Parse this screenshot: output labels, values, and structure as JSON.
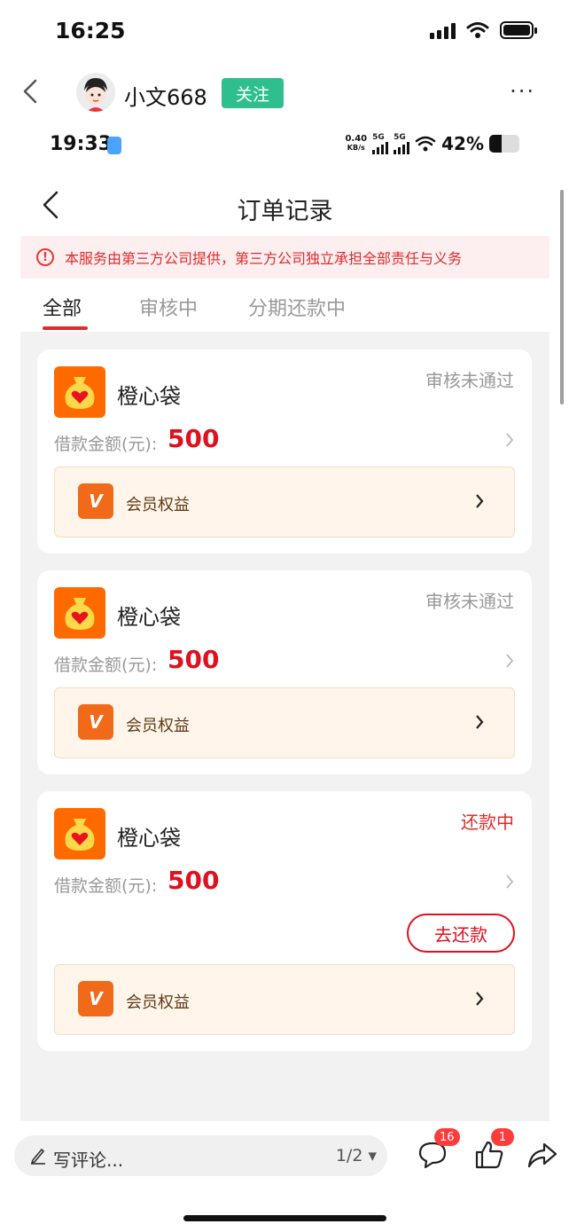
{
  "os_status": {
    "time": "16:25"
  },
  "post_header": {
    "author": "小文668",
    "follow_label": "关注"
  },
  "inner": {
    "status": {
      "time": "19:33",
      "speed": "0.40",
      "speed_unit": "KB/s",
      "net1": "5G",
      "net2": "5G",
      "battery": "42%"
    },
    "nav_title": "订单记录",
    "notice": "本服务由第三方公司提供，第三方公司独立承担全部责任与义务",
    "tabs": [
      "全部",
      "审核中",
      "分期还款中"
    ],
    "orders": [
      {
        "product": "橙心袋",
        "status": "审核未通过",
        "amount_label": "借款金额(元):",
        "amount": "500",
        "vip_label": "会员权益"
      },
      {
        "product": "橙心袋",
        "status": "审核未通过",
        "amount_label": "借款金额(元):",
        "amount": "500",
        "vip_label": "会员权益"
      },
      {
        "product": "橙心袋",
        "status": "还款中",
        "amount_label": "借款金额(元):",
        "amount": "500",
        "repay_label": "去还款",
        "vip_label": "会员权益"
      }
    ]
  },
  "bottom_bar": {
    "comment_placeholder": "写评论...",
    "page_indicator": "1/2",
    "comment_count": "16",
    "like_count": "1"
  },
  "colors": {
    "accent_red": "#e0101e",
    "follow_green": "#2fbf8e",
    "product_orange": "#ff6a00"
  }
}
